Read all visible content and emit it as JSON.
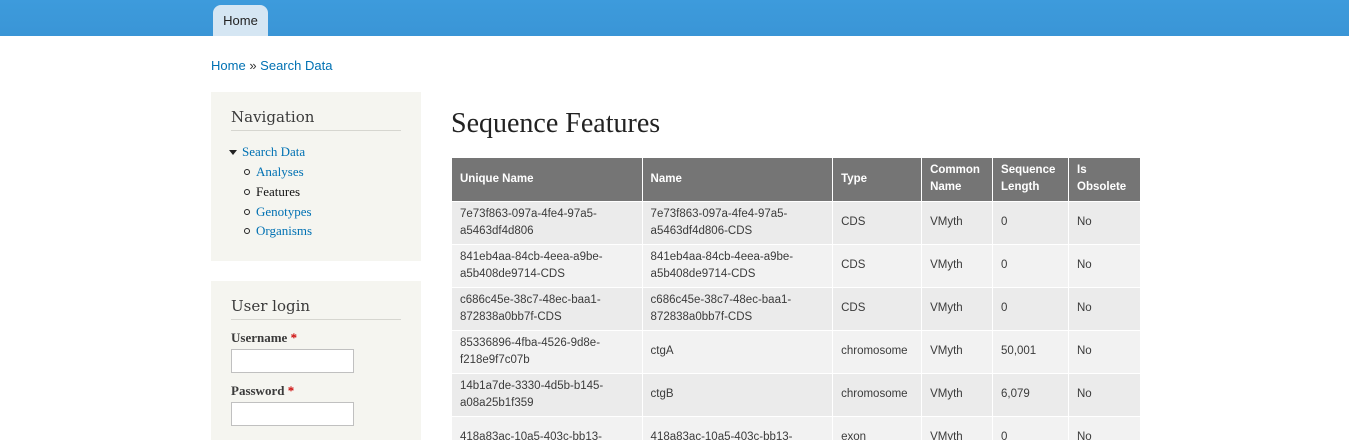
{
  "topbar": {
    "home_tab": "Home"
  },
  "breadcrumb": {
    "home": "Home",
    "separator": "»",
    "current": "Search Data"
  },
  "navigation": {
    "title": "Navigation",
    "parent": "Search Data",
    "children": [
      "Analyses",
      "Features",
      "Genotypes",
      "Organisms"
    ],
    "active": "Features"
  },
  "login": {
    "title": "User login",
    "username_label": "Username",
    "password_label": "Password",
    "required_mark": "*"
  },
  "page_title": "Sequence Features",
  "table": {
    "headers": [
      "Unique Name",
      "Name",
      "Type",
      "Common Name",
      "Sequence Length",
      "Is Obsolete"
    ],
    "rows": [
      [
        "7e73f863-097a-4fe4-97a5-a5463df4d806",
        "7e73f863-097a-4fe4-97a5-a5463df4d806-CDS",
        "CDS",
        "VMyth",
        "0",
        "No"
      ],
      [
        "841eb4aa-84cb-4eea-a9be-a5b408de9714-CDS",
        "841eb4aa-84cb-4eea-a9be-a5b408de9714-CDS",
        "CDS",
        "VMyth",
        "0",
        "No"
      ],
      [
        "c686c45e-38c7-48ec-baa1-872838a0bb7f-CDS",
        "c686c45e-38c7-48ec-baa1-872838a0bb7f-CDS",
        "CDS",
        "VMyth",
        "0",
        "No"
      ],
      [
        "85336896-4fba-4526-9d8e-f218e9f7c07b",
        "ctgA",
        "chromosome",
        "VMyth",
        "50,001",
        "No"
      ],
      [
        "14b1a7de-3330-4d5b-b145-a08a25b1f359",
        "ctgB",
        "chromosome",
        "VMyth",
        "6,079",
        "No"
      ],
      [
        "418a83ac-10a5-403c-bb13-",
        "418a83ac-10a5-403c-bb13-",
        "exon",
        "VMyth",
        "0",
        "No"
      ]
    ]
  }
}
